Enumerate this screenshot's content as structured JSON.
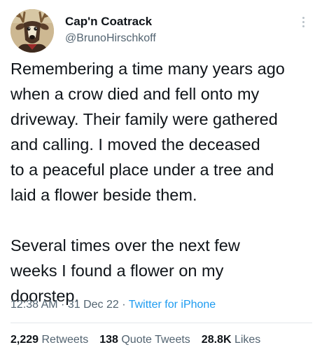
{
  "author": {
    "display_name": "Cap'n Coatrack",
    "handle": "@BrunoHirschkoff",
    "avatar_icon": "deer-avatar-icon"
  },
  "menu": {
    "icon": "more-vertical-icon"
  },
  "tweet": {
    "paragraphs": [
      "Remembering a time many years ago\nwhen a crow died and fell onto my\ndriveway. Their family were gathered\nand calling. I moved the deceased\nto a peaceful place under a tree and\nlaid a flower beside them.",
      "Several times over the next few\nweeks I found a flower on my\ndoorstep."
    ],
    "time": "12:38 AM",
    "separator": " · ",
    "date": "31 Dec 22",
    "source": "Twitter for iPhone"
  },
  "stats": {
    "retweets_count": "2,229",
    "retweets_label": "Retweets",
    "quotes_count": "138",
    "quotes_label": "Quote Tweets",
    "likes_count": "28.8K",
    "likes_label": "Likes"
  },
  "colors": {
    "text": "#0f1419",
    "secondary": "#536471",
    "link": "#1d9bf0",
    "divider": "#e3e7ea"
  }
}
